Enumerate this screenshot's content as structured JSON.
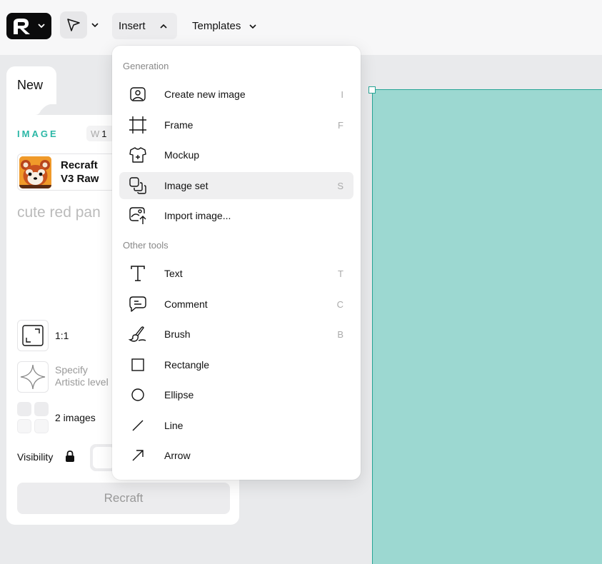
{
  "toolbar": {
    "insert_label": "Insert",
    "templates_label": "Templates"
  },
  "panel": {
    "tab_label": "New",
    "section_label": "IMAGE",
    "width_label": "W",
    "width_value": "1",
    "model_name": "Recraft V3 Raw",
    "prompt_text": "cute red pan",
    "ratio_label": "1:1",
    "style_label_1": "Specify",
    "style_label_2": "Artistic level",
    "count_label": "2 images",
    "visibility_label": "Visibility",
    "generate_label": "Recraft"
  },
  "menu": {
    "generation_header": "Generation",
    "other_header": "Other tools",
    "generation_items": [
      {
        "label": "Create new image",
        "key": "I",
        "icon": "image-icon"
      },
      {
        "label": "Frame",
        "key": "F",
        "icon": "frame-icon"
      },
      {
        "label": "Mockup",
        "key": "",
        "icon": "tshirt-icon"
      },
      {
        "label": "Image set",
        "key": "S",
        "icon": "image-set-icon"
      },
      {
        "label": "Import image...",
        "key": "",
        "icon": "import-image-icon"
      }
    ],
    "other_items": [
      {
        "label": "Text",
        "key": "T",
        "icon": "text-icon"
      },
      {
        "label": "Comment",
        "key": "C",
        "icon": "comment-icon"
      },
      {
        "label": "Brush",
        "key": "B",
        "icon": "brush-icon"
      },
      {
        "label": "Rectangle",
        "key": "",
        "icon": "rectangle-icon"
      },
      {
        "label": "Ellipse",
        "key": "",
        "icon": "ellipse-icon"
      },
      {
        "label": "Line",
        "key": "",
        "icon": "line-icon"
      },
      {
        "label": "Arrow",
        "key": "",
        "icon": "arrow-icon"
      }
    ]
  },
  "colors": {
    "accent": "#2bb7a6",
    "canvas_fill": "#9cd8d1",
    "canvas_border": "#27a596"
  }
}
